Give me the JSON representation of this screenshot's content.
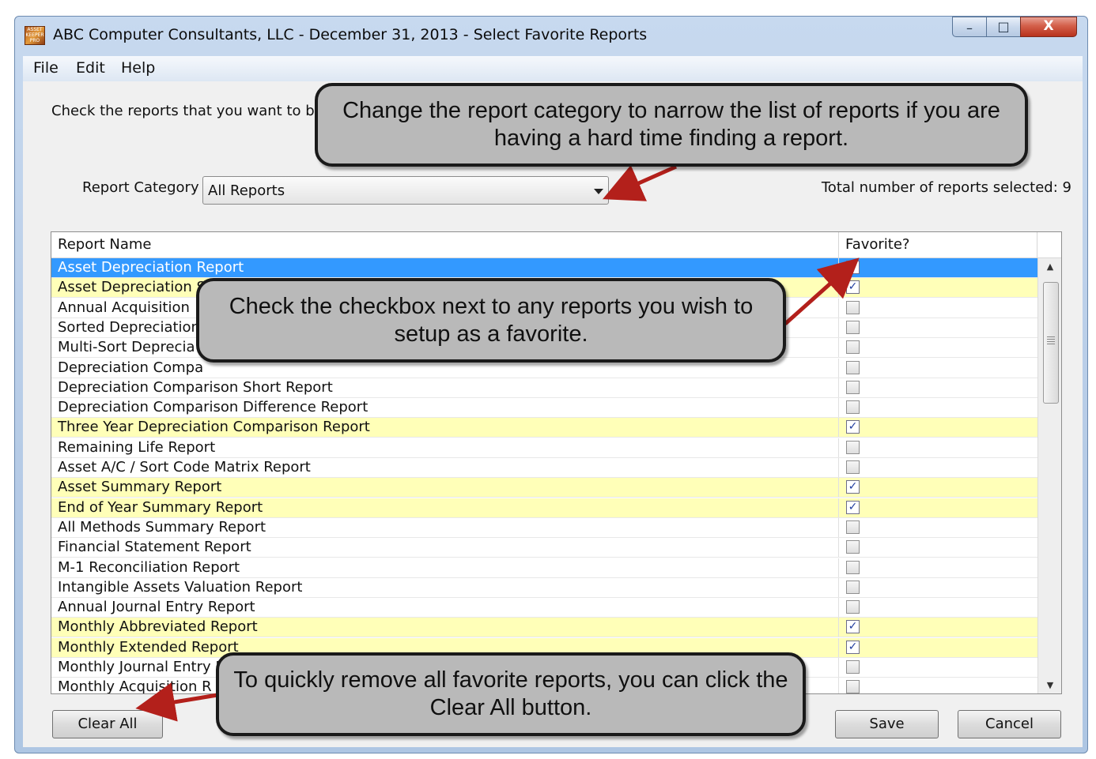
{
  "window": {
    "title": "ABC Computer Consultants, LLC - December 31, 2013 - Select Favorite Reports",
    "icon": "app-logo-icon",
    "controls": {
      "minimize": "–",
      "maximize": "□",
      "close": "X"
    }
  },
  "menu": [
    "File",
    "Edit",
    "Help"
  ],
  "instructions": "Check the reports that you want to be",
  "report_category": {
    "label": "Report Category",
    "selected": "All Reports"
  },
  "total_selected": {
    "label": "Total number of reports selected:",
    "value": "9"
  },
  "table": {
    "columns": [
      "Report Name",
      "Favorite?"
    ],
    "rows": [
      {
        "name": "Asset Depreciation Report",
        "favorite": true,
        "selected": true
      },
      {
        "name": "Asset Depreciation Short Report",
        "favorite": true,
        "selected": false
      },
      {
        "name": "Annual Acquisition",
        "favorite": false,
        "selected": false
      },
      {
        "name": "Sorted Depreciation",
        "favorite": false,
        "selected": false
      },
      {
        "name": "Multi-Sort Deprecia",
        "favorite": false,
        "selected": false
      },
      {
        "name": "Depreciation Compa",
        "favorite": false,
        "selected": false
      },
      {
        "name": "Depreciation Comparison Short Report",
        "favorite": false,
        "selected": false
      },
      {
        "name": "Depreciation Comparison Difference Report",
        "favorite": false,
        "selected": false
      },
      {
        "name": "Three Year Depreciation Comparison Report",
        "favorite": true,
        "selected": false
      },
      {
        "name": "Remaining Life Report",
        "favorite": false,
        "selected": false
      },
      {
        "name": "Asset A/C / Sort Code Matrix Report",
        "favorite": false,
        "selected": false
      },
      {
        "name": "Asset Summary Report",
        "favorite": true,
        "selected": false
      },
      {
        "name": "End of Year Summary Report",
        "favorite": true,
        "selected": false
      },
      {
        "name": "All Methods Summary Report",
        "favorite": false,
        "selected": false
      },
      {
        "name": "Financial Statement Report",
        "favorite": false,
        "selected": false
      },
      {
        "name": "M-1 Reconciliation Report",
        "favorite": false,
        "selected": false
      },
      {
        "name": "Intangible Assets Valuation Report",
        "favorite": false,
        "selected": false
      },
      {
        "name": "Annual Journal Entry Report",
        "favorite": false,
        "selected": false
      },
      {
        "name": "Monthly Abbreviated Report",
        "favorite": true,
        "selected": false
      },
      {
        "name": "Monthly Extended Report",
        "favorite": true,
        "selected": false
      },
      {
        "name": "Monthly Journal Entry Report",
        "favorite": false,
        "selected": false
      },
      {
        "name": "Monthly Acquisition R",
        "favorite": false,
        "selected": false
      }
    ]
  },
  "buttons": {
    "clear_all": "Clear All",
    "save": "Save",
    "cancel": "Cancel"
  },
  "callouts": {
    "category": "Change the report category to narrow the list of reports if you are having a hard time finding a report.",
    "checkbox": "Check the checkbox next to any reports you wish to setup as a favorite.",
    "clear": "To quickly remove all favorite reports, you can click the Clear All button."
  },
  "colors": {
    "selected_row": "#3399ff",
    "favorite_row": "#ffffb8",
    "arrow": "#b3201b",
    "callout_fill": "#b9b9b9"
  }
}
